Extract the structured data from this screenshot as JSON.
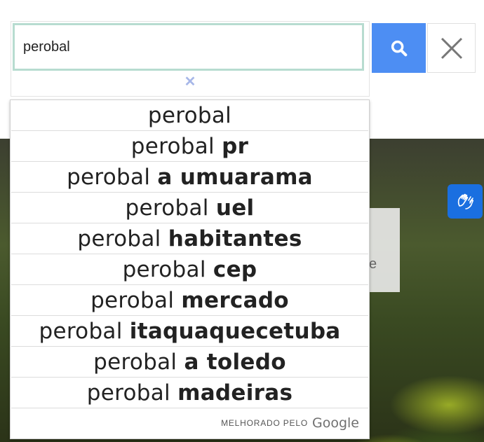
{
  "search": {
    "value": "perobal",
    "clear_glyph": "✕"
  },
  "suggestions": [
    {
      "query": "perobal",
      "completion": ""
    },
    {
      "query": "perobal ",
      "completion": "pr"
    },
    {
      "query": "perobal ",
      "completion": "a umuarama"
    },
    {
      "query": "perobal ",
      "completion": "uel"
    },
    {
      "query": "perobal ",
      "completion": "habitantes"
    },
    {
      "query": "perobal ",
      "completion": "cep"
    },
    {
      "query": "perobal ",
      "completion": "mercado"
    },
    {
      "query": "perobal ",
      "completion": "itaquaquecetuba"
    },
    {
      "query": "perobal ",
      "completion": "a toledo"
    },
    {
      "query": "perobal ",
      "completion": "madeiras"
    }
  ],
  "powered_by": {
    "label": "MELHORADO PELO",
    "brand": "Google"
  },
  "background_card": {
    "text": "e"
  },
  "icons": {
    "search": "search-icon",
    "close": "close-icon",
    "accessibility": "sign-language-icon"
  },
  "colors": {
    "search_button": "#4d8ef3",
    "input_border": "#b7dcd0",
    "accessibility_button": "#1a6fe0"
  }
}
